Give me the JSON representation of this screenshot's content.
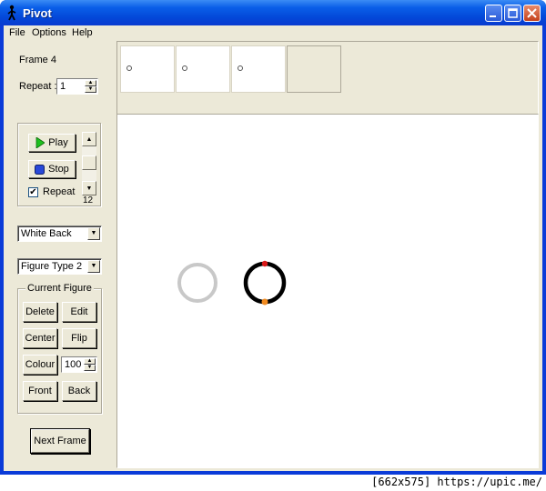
{
  "window": {
    "title": "Pivot"
  },
  "menu": {
    "items": [
      "File",
      "Options",
      "Help"
    ]
  },
  "frame_info": {
    "label": "Frame 4",
    "repeat_label": "Repeat :",
    "repeat_value": "1"
  },
  "frames": {
    "thumbnails": [
      "frame-1",
      "frame-2",
      "frame-3",
      "empty"
    ]
  },
  "playback": {
    "play_label": "Play",
    "stop_label": "Stop",
    "repeat_label": "Repeat",
    "repeat_checked": true,
    "speed_value": "12"
  },
  "background": {
    "selected": "White Back"
  },
  "figure_type": {
    "selected": "Figure Type 2"
  },
  "current_figure": {
    "legend": "Current Figure",
    "delete_label": "Delete",
    "edit_label": "Edit",
    "center_label": "Center",
    "flip_label": "Flip",
    "colour_label": "Colour",
    "colour_value": "100",
    "front_label": "Front",
    "back_label": "Back"
  },
  "next_frame_label": "Next Frame",
  "footer": {
    "text": "[662x575] https://upic.me/"
  },
  "colors": {
    "title_bar": "#0a5ee8",
    "panel": "#ece9d8",
    "handle_red": "#d81818",
    "handle_orange": "#f08a20",
    "ghost_figure": "#c8c8c8"
  }
}
